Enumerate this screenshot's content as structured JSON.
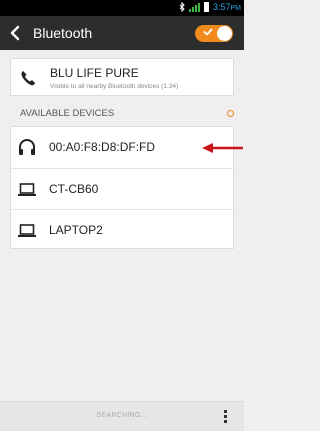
{
  "status_bar": {
    "time": "3:57",
    "ampm": "PM",
    "icons": [
      "bluetooth-icon",
      "signal-icon",
      "battery-icon"
    ]
  },
  "header": {
    "title": "Bluetooth",
    "toggle_state": "on",
    "accent_color": "#f08a1c"
  },
  "this_device": {
    "name": "BLU LIFE PURE",
    "subtitle": "Visible to all nearby Bluetooth devices (1:34)",
    "icon": "phone-icon"
  },
  "available": {
    "label": "AVAILABLE DEVICES",
    "devices": [
      {
        "name": "00:A0:F8:D8:DF:FD",
        "icon": "headphones-icon"
      },
      {
        "name": "CT-CB60",
        "icon": "laptop-icon"
      },
      {
        "name": "LAPTOP2",
        "icon": "laptop-icon"
      }
    ]
  },
  "bottom_bar": {
    "status": "SEARCHING...",
    "menu_icon": "overflow-menu-icon"
  },
  "annotation": {
    "arrow_color": "#c8151b"
  }
}
